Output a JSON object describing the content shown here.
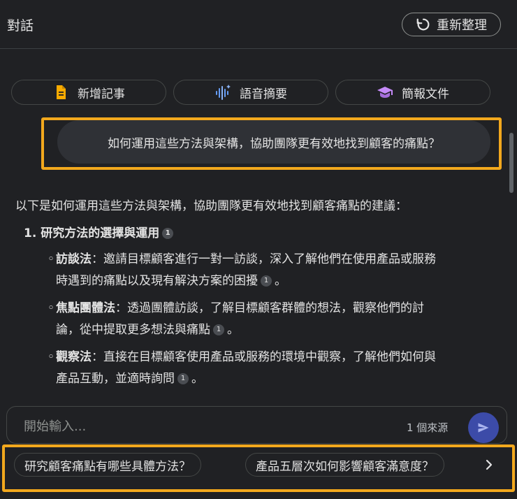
{
  "header": {
    "title": "對話",
    "reset_label": "重新整理"
  },
  "chips": [
    {
      "label": "新增記事",
      "icon": "note-icon",
      "color": "#f9ab00"
    },
    {
      "label": "語音摘要",
      "icon": "audio-waveform-icon",
      "color": "#669df6"
    },
    {
      "label": "簡報文件",
      "icon": "graduation-cap-icon",
      "color": "#c58af9"
    }
  ],
  "user_message": "如何運用這些方法與架構，協助團隊更有效地找到顧客的痛點？",
  "answer": {
    "intro": "以下是如何運用這些方法與架構，協助團隊更有效地找到顧客痛點的建議：",
    "section_title": "1. 研究方法的選擇與運用",
    "section_cite": "1",
    "items": [
      {
        "term": "訪談法",
        "text": "：邀請目標顧客進行一對一訪談，深入了解他們在使用產品或服務時遇到的痛點以及現有解決方案的困擾",
        "cite": "1",
        "end": "。"
      },
      {
        "term": "焦點團體法",
        "text": "：透過團體訪談，了解目標顧客群體的想法，觀察他們的討論，從中提取更多想法與痛點",
        "cite": "1",
        "end": "。"
      },
      {
        "term": "觀察法",
        "text": "：直接在目標顧客使用產品或服務的環境中觀察，了解他們如何與產品互動，並適時詢問",
        "cite": "1",
        "end": "。"
      }
    ]
  },
  "input": {
    "placeholder": "開始輸入...",
    "source_count": "1 個來源"
  },
  "suggestions": [
    "研究顧客痛點有哪些具體方法？",
    "產品五層次如何影響顧客滿意度？"
  ],
  "colors": {
    "highlight": "#f2a81d",
    "send_button": "#3c4ba8"
  }
}
